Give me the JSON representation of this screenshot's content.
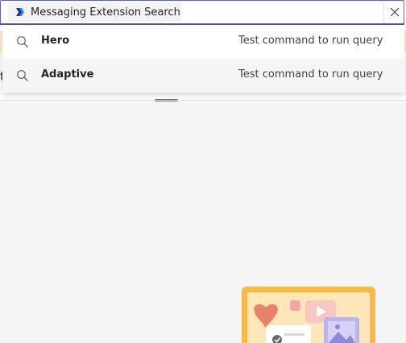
{
  "search": {
    "app_name": "Messaging Extension Search"
  },
  "background": {
    "tab_letter": "t"
  },
  "results": [
    {
      "title": "Hero",
      "description": "Test command to run query"
    },
    {
      "title": "Adaptive",
      "description": "Test command to run query"
    }
  ],
  "icons": {
    "app": "app-logo-icon",
    "result": "search-icon",
    "close": "close-icon",
    "illustration": "empty-state-illustration"
  },
  "colors": {
    "accent": "#5b5fc7",
    "banner": "#fbf0d2",
    "illustration_frame": "#f6b94a"
  }
}
